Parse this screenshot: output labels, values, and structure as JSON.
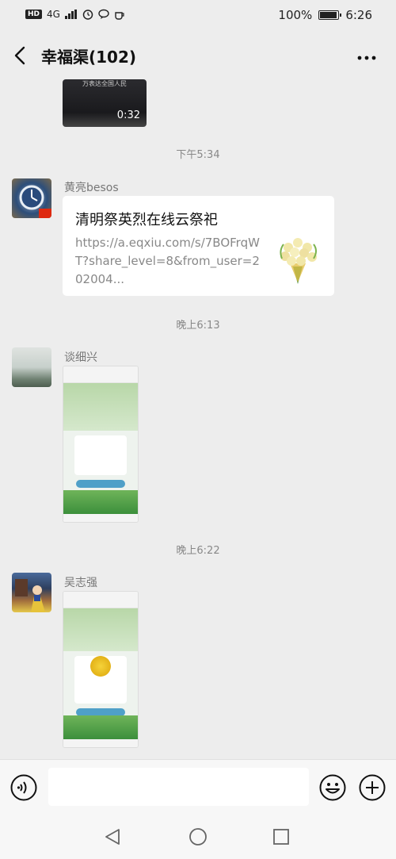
{
  "status_bar": {
    "network": "4G",
    "battery_percent": "100%",
    "time": "6:26",
    "battery_level": 1.0
  },
  "header": {
    "title": "幸福渠(102)",
    "back_icon": "chevron-left-icon",
    "more_icon": "more-dots-icon"
  },
  "messages": {
    "video": {
      "caption": "万表达全国人民",
      "duration": "0:32"
    },
    "time_1": "下午5:34",
    "msg_1": {
      "sender": "黄亮besos",
      "link_title": "清明祭英烈在线云祭祀",
      "link_url": "https://a.eqxiu.com/s/7BOFrqWT?share_level=8&from_user=202004..."
    },
    "time_2": "晚上6:13",
    "msg_2": {
      "sender": "谈细兴"
    },
    "time_3": "晚上6:22",
    "msg_3": {
      "sender": "吴志强"
    }
  },
  "input_bar": {
    "placeholder": "",
    "voice_icon": "voice-icon",
    "emoji_icon": "emoji-icon",
    "plus_icon": "plus-icon"
  },
  "nav_bar": {
    "back_icon": "triangle-back-icon",
    "home_icon": "circle-home-icon",
    "recent_icon": "square-recent-icon"
  }
}
